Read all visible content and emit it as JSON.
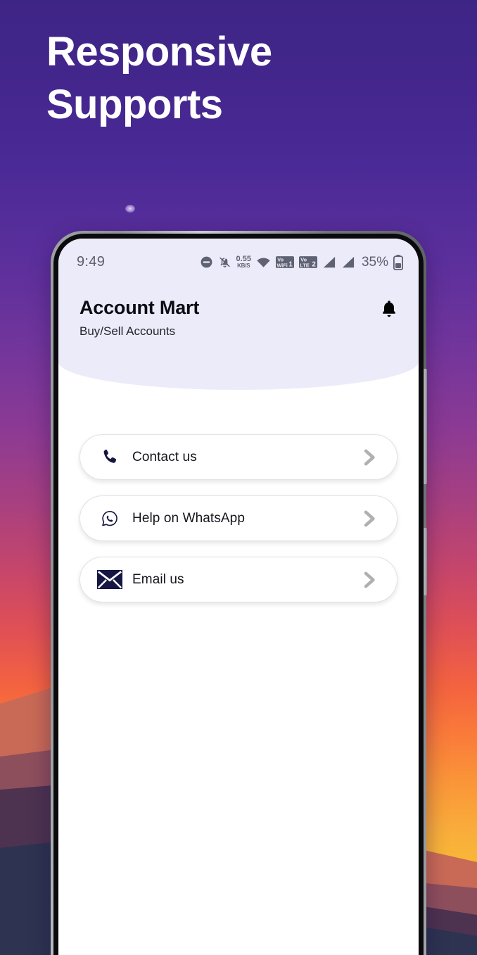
{
  "promo": {
    "headline": "Responsive\nSupports",
    "headline_color": "#ffffff",
    "bg_top_color": "#3d2585",
    "bg_mid_color": "#b0436f",
    "bg_bottom_color": "#f3c92c"
  },
  "phone": {
    "statusbar": {
      "time": "9:49",
      "dnd_icon": "do-not-disturb-icon",
      "mute_icon": "bell-muted-icon",
      "data_rate_value": "0.55",
      "data_rate_unit": "KB/S",
      "wifi_icon": "wifi-icon",
      "volte_sim1_top": "Vo",
      "volte_sim1_bottom": "WiFi",
      "volte_sim1_num": "1",
      "volte_sim2_top": "Vo",
      "volte_sim2_bottom": "LTE",
      "volte_sim2_num": "2",
      "signal_sim1_icon": "signal-bars-icon",
      "signal_sim2_icon": "signal-bars-icon",
      "battery_percent": "35%",
      "battery_icon": "battery-icon"
    },
    "header": {
      "title": "Account Mart",
      "subtitle": "Buy/Sell Accounts",
      "notification_icon": "bell-icon",
      "background_color": "#ecebf9"
    },
    "support_items": [
      {
        "label": "Contact us",
        "icon": "phone-icon",
        "chevron": "chevron-right-icon"
      },
      {
        "label": "Help on WhatsApp",
        "icon": "whatsapp-icon",
        "chevron": "chevron-right-icon"
      },
      {
        "label": "Email us",
        "icon": "email-icon",
        "chevron": "chevron-right-icon"
      }
    ],
    "icon_color": "#151642",
    "chevron_color": "#b0b0b0"
  }
}
